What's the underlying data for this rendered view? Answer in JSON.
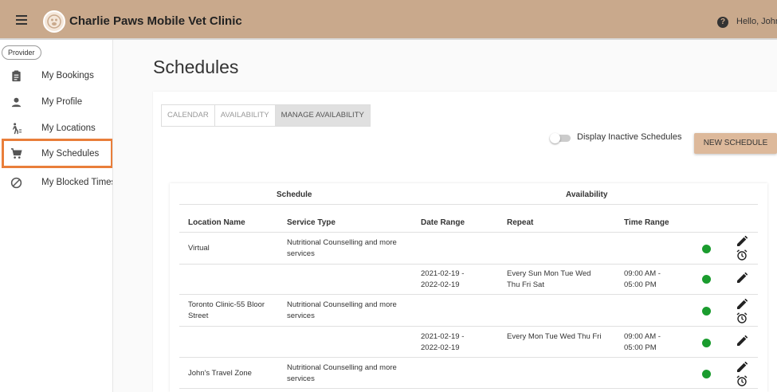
{
  "header": {
    "menu_icon": "hamburger-menu-icon",
    "logo_icon": "clinic-logo-icon",
    "title": "Charlie Paws Mobile Vet Clinic",
    "help_icon": "help-circle-icon",
    "greeting": "Hello, John",
    "bg_color": "#c9a98c"
  },
  "sidebar": {
    "role_badge": "Provider",
    "items": [
      {
        "label": "My Bookings",
        "icon": "clipboard-icon"
      },
      {
        "label": "My Profile",
        "icon": "person-icon"
      },
      {
        "label": "My Locations",
        "icon": "walking-person-icon"
      },
      {
        "label": "My Schedules",
        "icon": "cart-icon",
        "highlighted": true
      },
      {
        "label": "My Blocked Times",
        "icon": "block-icon"
      }
    ],
    "highlight_color": "#e97e3a"
  },
  "page": {
    "title": "Schedules",
    "tabs": [
      {
        "label": "CALENDAR",
        "active": false
      },
      {
        "label": "AVAILABILITY",
        "active": false
      },
      {
        "label": "MANAGE AVAILABILITY",
        "active": true
      }
    ],
    "inactive_toggle": {
      "label": "Display Inactive Schedules",
      "on": false
    },
    "new_button": "NEW SCHEDULE",
    "accent_color": "#ddb99b"
  },
  "table": {
    "group_headers": {
      "schedule": "Schedule",
      "availability": "Availability"
    },
    "columns": [
      "Location Name",
      "Service Type",
      "Date Range",
      "Repeat",
      "Time Range"
    ],
    "rows": [
      {
        "kind": "location",
        "location": "Virtual",
        "service": "Nutritional Counselling and more services",
        "date_range": "",
        "repeat": "",
        "time_range": "",
        "status": "active"
      },
      {
        "kind": "availability",
        "location": "",
        "service": "",
        "date_range": "2021-02-19 - 2022-02-19",
        "repeat": "Every Sun Mon Tue Wed Thu Fri Sat",
        "time_range": "09:00 AM - 05:00 PM",
        "status": "active"
      },
      {
        "kind": "location",
        "location": "Toronto Clinic-55 Bloor Street",
        "service": "Nutritional Counselling and more services",
        "date_range": "",
        "repeat": "",
        "time_range": "",
        "status": "active"
      },
      {
        "kind": "availability",
        "location": "",
        "service": "",
        "date_range": "2021-02-19 - 2022-02-19",
        "repeat": "Every Mon Tue Wed Thu Fri",
        "time_range": "09:00 AM - 05:00 PM",
        "status": "active"
      },
      {
        "kind": "location",
        "location": "John's Travel Zone",
        "service": "Nutritional Counselling and more services",
        "date_range": "",
        "repeat": "",
        "time_range": "",
        "status": "active"
      }
    ],
    "status_color": "#1a9c2e",
    "edit_icon": "pencil-edit-icon",
    "alarm_icon": "alarm-clock-icon"
  }
}
